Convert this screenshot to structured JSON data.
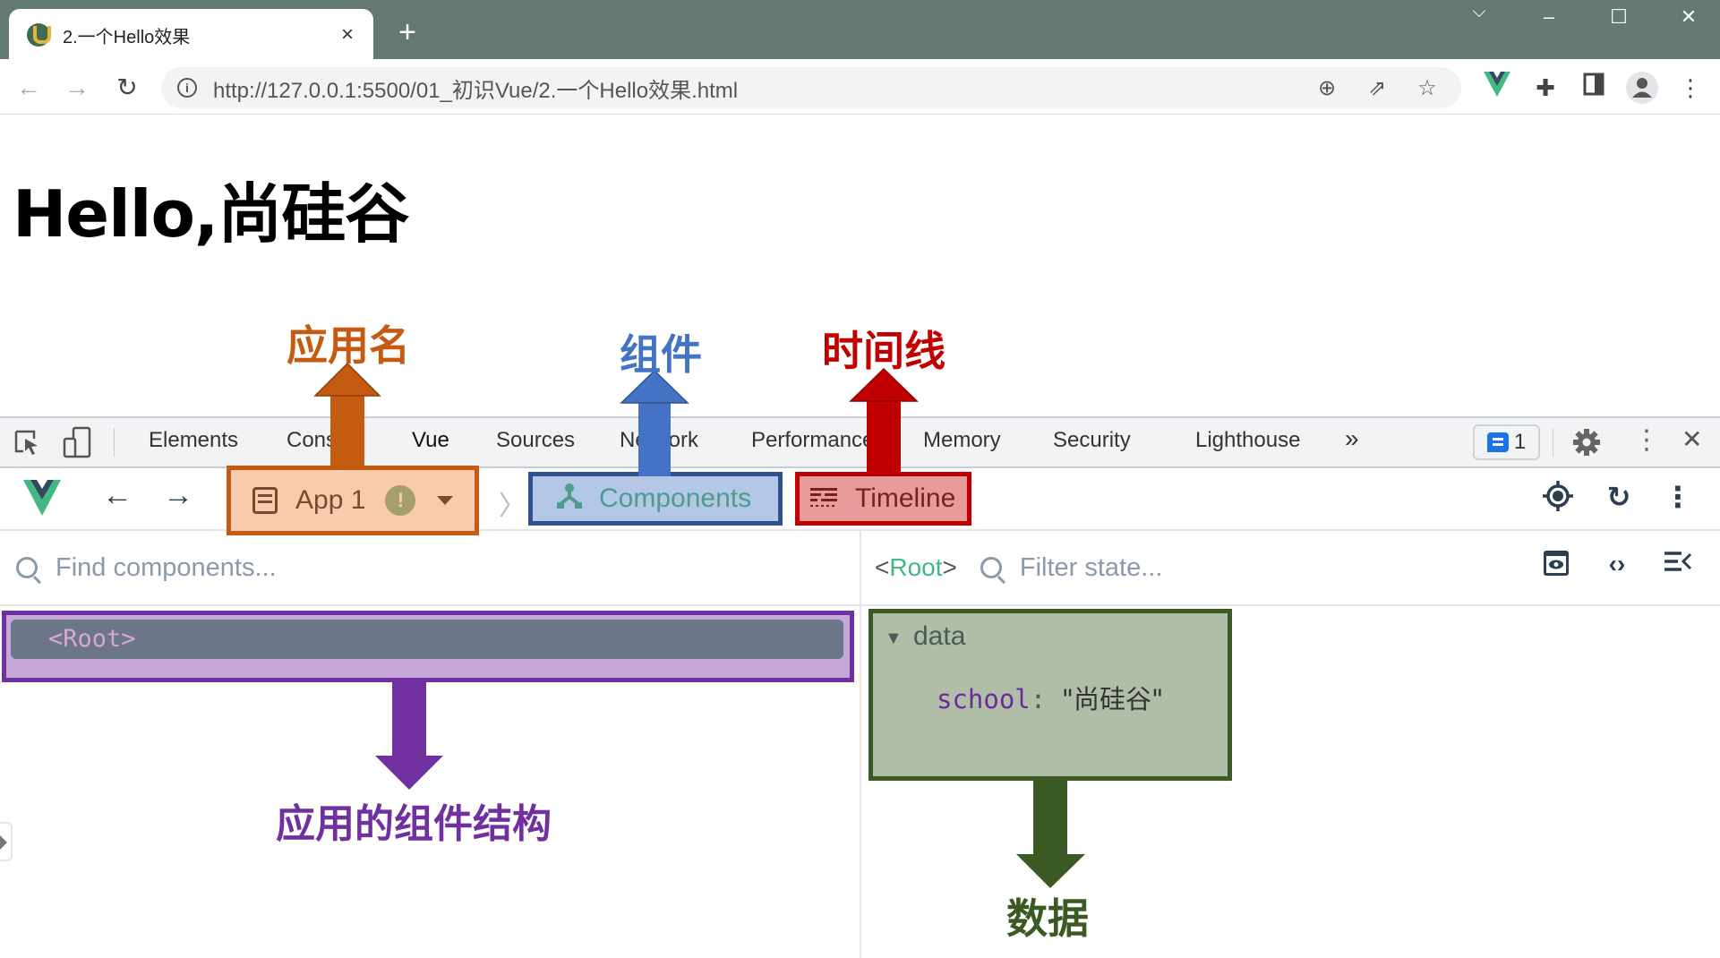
{
  "browser": {
    "tab_title": "2.一个Hello效果",
    "tab_close": "×",
    "new_tab": "+",
    "window_controls": {
      "menu": "⌵",
      "minimize": "–",
      "maximize": "☐",
      "close": "✕"
    },
    "nav": {
      "back": "←",
      "forward": "→",
      "reload": "↻"
    },
    "url": "http://127.0.0.1:5500/01_初识Vue/2.一个Hello效果.html",
    "url_icons": [
      "zoom-icon",
      "share-icon",
      "bookmark-star-icon"
    ],
    "extension_icons": [
      "vue-devtools-icon",
      "extensions-puzzle-icon",
      "side-panel-icon",
      "profile-avatar-icon",
      "browser-menu-icon"
    ]
  },
  "page": {
    "heading": "Hello,尚硅谷"
  },
  "devtools": {
    "tabs": [
      "Elements",
      "Console",
      "Vue",
      "Sources",
      "Network",
      "Performance",
      "Memory",
      "Security",
      "Lighthouse"
    ],
    "more_tabs": "»",
    "issues_count": "1",
    "vue": {
      "nav_back": "←",
      "nav_forward": "→",
      "app_name": "App 1",
      "app_warning": "!",
      "breadcrumb_chevron": "〉",
      "components_label": "Components",
      "timeline_label": "Timeline",
      "find_components_placeholder": "Find components...",
      "tree": [
        {
          "label": "<Root>",
          "selected": true
        }
      ],
      "inspector": {
        "root_open": "<",
        "root_name": "Root",
        "root_close": ">",
        "filter_placeholder": "Filter state...",
        "section": "data",
        "section_toggle": "▼",
        "fields": [
          {
            "key": "school",
            "value": "\"尚硅谷\""
          }
        ]
      }
    }
  },
  "annotations": {
    "app_name": {
      "text": "应用名",
      "color": "#c55a11"
    },
    "components": {
      "text": "组件",
      "color": "#4472c4"
    },
    "timeline": {
      "text": "时间线",
      "color": "#c00000"
    },
    "component_tree": {
      "text": "应用的组件结构",
      "color": "#7030a0"
    },
    "data": {
      "text": "数据",
      "color": "#3b5a23"
    }
  }
}
